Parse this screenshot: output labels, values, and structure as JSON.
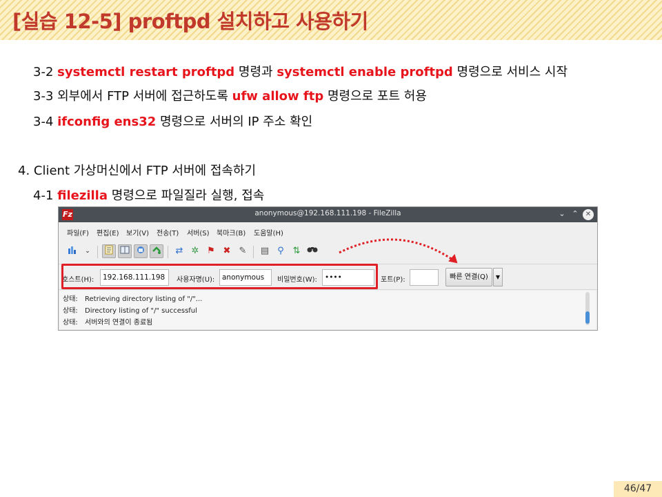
{
  "slide": {
    "title": "[실습 12-5] proftpd 설치하고 사용하기",
    "page": "46/47",
    "colors": {
      "accent_red": "#e8141c",
      "title_red": "#c0392b",
      "banner": "#fdf1c9"
    }
  },
  "lines": {
    "l1": {
      "num": "3-2 ",
      "cmd1": "systemctl restart proftpd",
      "mid": " 명령과 ",
      "cmd2": "systemctl enable proftpd",
      "end": " 명령으로 서비스 시작"
    },
    "l2": {
      "num": "3-3 외부에서 FTP 서버에 접근하도록 ",
      "cmd": "ufw allow ftp",
      "end": " 명령으로 포트 허용"
    },
    "l3": {
      "num": "3-4 ",
      "cmd": "ifconfig ens32",
      "end": " 명령으로 서버의 IP 주소 확인"
    },
    "l4": {
      "text": "4. Client 가상머신에서 FTP 서버에 접속하기"
    },
    "l5": {
      "num": "4-1 ",
      "cmd": "filezilla",
      "end": " 명령으로 파일질라 실행, 접속"
    }
  },
  "filezilla": {
    "app_icon": "Fz",
    "window_title": "anonymous@192.168.111.198 - FileZilla",
    "window_buttons": {
      "minimize": "⌄",
      "maximize": "⌃",
      "close": "✕"
    },
    "menu": [
      "파일(F)",
      "편집(E)",
      "보기(V)",
      "전송(T)",
      "서버(S)",
      "북마크(B)",
      "도움말(H)"
    ],
    "toolbar_icons": [
      "site-manager-icon",
      "dropdown-icon",
      "toggle-log-icon",
      "toggle-tree-icon",
      "toggle-queue-icon",
      "refresh-icon",
      "process-queue-icon",
      "cancel-icon",
      "disconnect-icon",
      "reconnect-icon",
      "filter-icon",
      "compare-icon",
      "sync-icon",
      "search-icon",
      "binoculars-icon"
    ],
    "quickconnect": {
      "host_label": "호스트(H):",
      "host_value": "192.168.111.198",
      "user_label": "사용자명(U):",
      "user_value": "anonymous",
      "pass_label": "비밀번호(W):",
      "pass_value": "••••",
      "port_label": "포트(P):",
      "port_value": "",
      "connect_label": "빠른 연결(Q)",
      "dropdown": "▼"
    },
    "log": [
      {
        "label": "상태:",
        "text": "Retrieving directory listing of \"/\"..."
      },
      {
        "label": "상태:",
        "text": "Directory listing of \"/\" successful"
      },
      {
        "label": "상태:",
        "text": "서버와의 연결이 종료됨"
      }
    ]
  }
}
